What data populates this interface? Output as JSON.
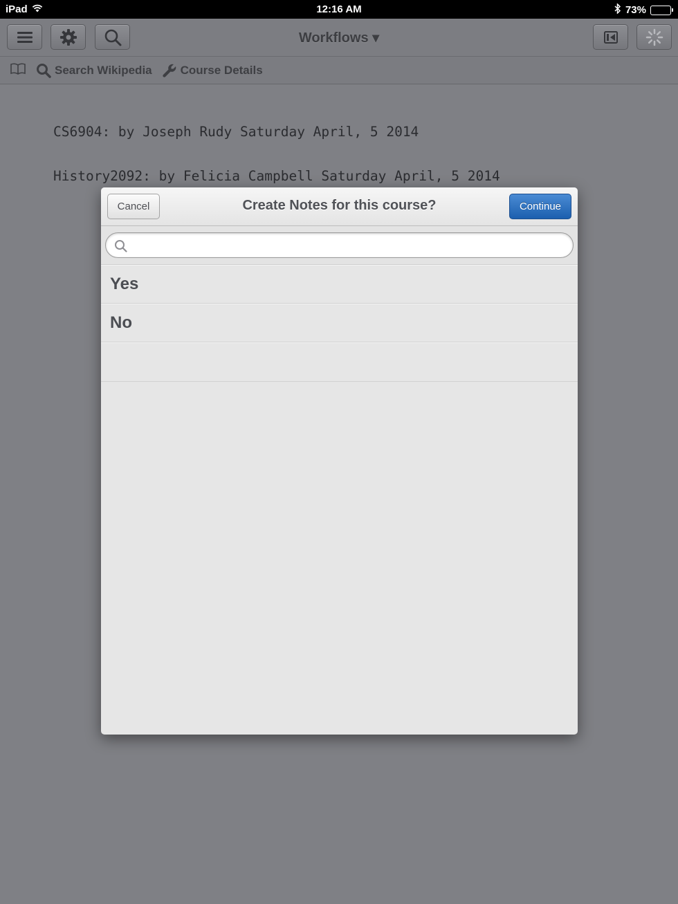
{
  "status_bar": {
    "device": "iPad",
    "time": "12:16 AM",
    "battery": "73%",
    "battery_level": 0.73
  },
  "toolbar": {
    "title": "Workflows ▾"
  },
  "subbar": {
    "search_wikipedia": "Search Wikipedia",
    "course_details": "Course Details"
  },
  "document": {
    "lines": [
      "CS6904: by Joseph Rudy Saturday April, 5 2014",
      "History2092: by Felicia Campbell Saturday April, 5 2014"
    ]
  },
  "modal": {
    "title": "Create Notes for this course?",
    "cancel_label": "Cancel",
    "continue_label": "Continue",
    "search_placeholder": "",
    "options": [
      "Yes",
      "No"
    ]
  }
}
